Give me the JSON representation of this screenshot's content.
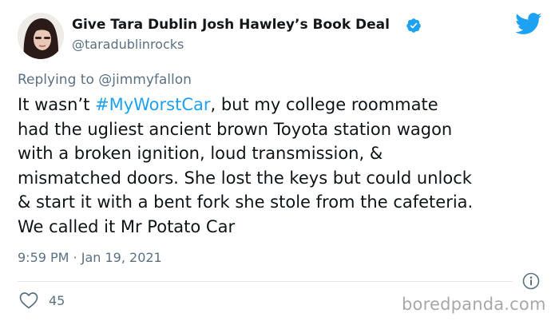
{
  "author": {
    "display_name": "Give Tara Dublin Josh Hawley’s Book Deal",
    "handle": "@taradublinrocks",
    "verified": true,
    "avatar_icon": "avatar-photo"
  },
  "reply": {
    "prefix": "Replying to ",
    "mention": "@jimmyfallon"
  },
  "tweet": {
    "lines": [
      {
        "pre": "It wasn’t ",
        "hashtag": "#MyWorstCar",
        "post": ", but my college roommate"
      },
      {
        "pre": "had the ugliest ancient brown Toyota station wagon",
        "hashtag": "",
        "post": ""
      },
      {
        "pre": "with a broken ignition, loud transmission, &",
        "hashtag": "",
        "post": ""
      },
      {
        "pre": "mismatched doors. She lost the keys but could unlock",
        "hashtag": "",
        "post": ""
      },
      {
        "pre": "& start it with a bent fork she stole from the cafeteria.",
        "hashtag": "",
        "post": ""
      },
      {
        "pre": "We called it Mr Potato Car",
        "hashtag": "",
        "post": ""
      }
    ],
    "timestamp": "9:59 PM · Jan 19, 2021"
  },
  "actions": {
    "like_icon": "heart-icon",
    "like_count": "45",
    "info_icon": "info-icon"
  },
  "brand": {
    "twitter_icon": "twitter-bird-icon",
    "twitter_color": "#1da1f2",
    "watermark": "boredpanda.com"
  }
}
